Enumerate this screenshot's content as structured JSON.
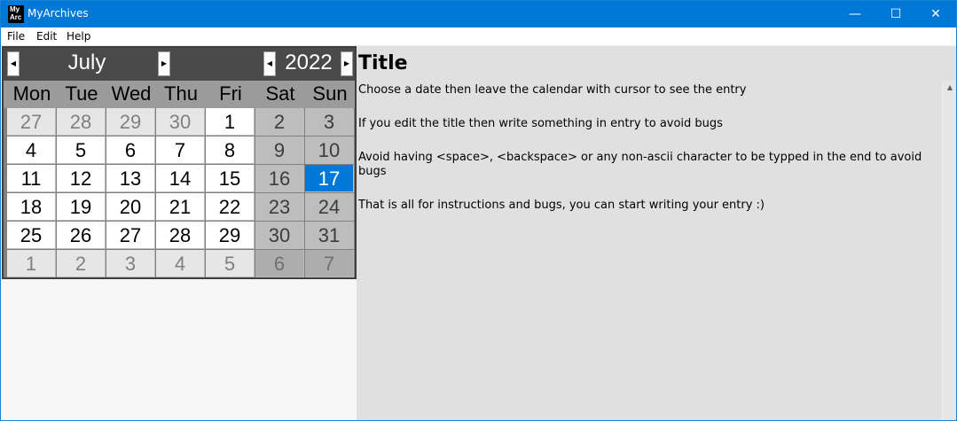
{
  "window": {
    "app_icon_text_1": "My",
    "app_icon_text_2": "Arc",
    "title": "MyArchives",
    "minimize": "—",
    "maximize": "☐",
    "close": "✕"
  },
  "menu": {
    "items": [
      {
        "label": "File"
      },
      {
        "label": "Edit"
      },
      {
        "label": "Help"
      }
    ]
  },
  "calendar": {
    "month": "July",
    "year": "2022",
    "prev_arrow": "◀",
    "next_arrow": "▶",
    "weekdays": [
      "Mon",
      "Tue",
      "Wed",
      "Thu",
      "Fri",
      "Sat",
      "Sun"
    ],
    "weeks": [
      [
        "27",
        "28",
        "29",
        "30",
        "1",
        "2",
        "3"
      ],
      [
        "4",
        "5",
        "6",
        "7",
        "8",
        "9",
        "10"
      ],
      [
        "11",
        "12",
        "13",
        "14",
        "15",
        "16",
        "17"
      ],
      [
        "18",
        "19",
        "20",
        "21",
        "22",
        "23",
        "24"
      ],
      [
        "25",
        "26",
        "27",
        "28",
        "29",
        "30",
        "31"
      ],
      [
        "1",
        "2",
        "3",
        "4",
        "5",
        "6",
        "7"
      ]
    ],
    "selected_day": "17",
    "colors": {
      "selected": "#0078d7",
      "header": "#4a4a4a",
      "weekend": "#bdbdbd"
    }
  },
  "entry": {
    "title": "Title",
    "lines": [
      "Choose a date then leave the calendar with cursor to see the entry",
      "If you edit the title then write something in entry to avoid bugs",
      "Avoid having <space>, <backspace> or any non-ascii character to be typped in the end to avoid bugs",
      "That is all for instructions and bugs, you can start writing your entry :)"
    ]
  },
  "scrollbar": {
    "up_arrow": "▲"
  }
}
